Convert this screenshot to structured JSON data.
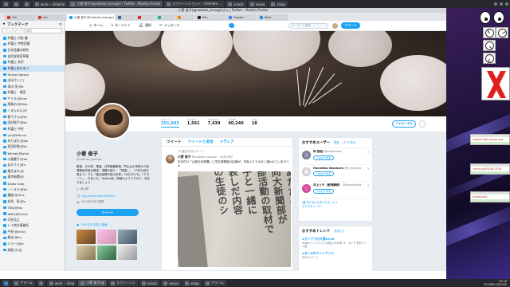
{
  "taskbar_top": {
    "tasks": [
      {
        "label": "",
        "active": false
      },
      {
        "label": "",
        "active": false
      },
      {
        "label": "",
        "active": false
      },
      {
        "label": "work -- Dolphin",
        "active": false
      },
      {
        "label": "小菅 俊子(@nobuko_kosuge) / Twitter - Mozilla Firefox",
        "active": true
      },
      {
        "label": "スクリーンショット - [homete ...",
        "active": false
      },
      {
        "label": "xclock",
        "active": false
      },
      {
        "label": "xeyes",
        "active": false
      },
      {
        "label": "xlogo",
        "active": false
      }
    ]
  },
  "browser": {
    "window_title": "小菅 俊子(@nobuko_kosuge)さん | Twitter - Mozilla Firefox",
    "tabs": [
      {
        "label": "Gm",
        "active": false
      },
      {
        "label": "Inb",
        "active": false
      },
      {
        "label": "小菅 俊子(@nobuko_kosuge)",
        "active": true
      },
      {
        "label": "",
        "active": false
      },
      {
        "label": "",
        "active": false
      },
      {
        "label": "",
        "active": false
      },
      {
        "label": "",
        "active": false
      },
      {
        "label": "Ello",
        "active": false
      },
      {
        "label": "Google",
        "active": false
      },
      {
        "label": "Mast",
        "active": false
      }
    ],
    "url": "https://twitter.com/nobuko_kosuge"
  },
  "sidebar": {
    "title": "ブックマーク",
    "search_placeholder": "ブックマークを検索",
    "items": [
      {
        "label": "弁護士 村松 謙",
        "selected": false
      },
      {
        "label": "弁護士 宇都宮健",
        "selected": false
      },
      {
        "label": "日本会議の研究",
        "selected": false
      },
      {
        "label": "自民党改憲草案",
        "selected": false
      },
      {
        "label": "弁護士 北村",
        "selected": false
      },
      {
        "label": "弁護士あかまつ",
        "selected": true
      },
      {
        "label": "Shoko Egawa(",
        "selected": false
      },
      {
        "label": "ばばけいこ(",
        "selected": false
      },
      {
        "label": "清水 潔(@k",
        "selected": false
      },
      {
        "label": "弁護士　堀田",
        "selected": false
      },
      {
        "label": "サイえ(@Fuw",
        "selected": false
      },
      {
        "label": "飛鳥の(@Hika",
        "selected": false
      },
      {
        "label": "くまんもん(@",
        "selected": false
      },
      {
        "label": "都下さん(@ta",
        "selected": false
      },
      {
        "label": "田村智子(@ta",
        "selected": false
      },
      {
        "label": "弁護士 中村",
        "selected": false
      },
      {
        "label": "y.b(@bfhuuz",
        "selected": false
      },
      {
        "label": "ゆとぽむ(@tol",
        "selected": false
      },
      {
        "label": "武田砂鉄(@ta",
        "selected": false
      },
      {
        "label": "Winkel(@wink",
        "selected": false
      },
      {
        "label": "小島慶子(@ke",
        "selected": false
      },
      {
        "label": "おのうえ(@n",
        "selected": false
      },
      {
        "label": "猫生まれ(@",
        "selected": false
      },
      {
        "label": "東京新聞(@",
        "selected": false
      },
      {
        "label": "Daiko Goto",
        "selected": false
      },
      {
        "label": "ノーステ(@ah",
        "selected": false
      },
      {
        "label": "蓮舫(@rens",
        "selected": false
      },
      {
        "label": "杉原　彰(@s",
        "selected": false
      },
      {
        "label": "TBS(@tbs",
        "selected": false
      },
      {
        "label": "SMU(@Schmi",
        "selected": false
      },
      {
        "label": "河合弘之",
        "selected": false
      },
      {
        "label": "レイ地方事務所",
        "selected": false
      },
      {
        "label": "今井(@shhcj",
        "selected": false
      },
      {
        "label": "勝ま(@ku",
        "selected": false
      },
      {
        "label": "ジョー(@ja",
        "selected": false
      },
      {
        "label": "高橋 大(@",
        "selected": false
      }
    ]
  },
  "twitter": {
    "nav": {
      "home": "ホーム",
      "moments": "モーメント",
      "notifications": "通知",
      "messages": "メッセージ"
    },
    "search_placeholder": "キーワード検索",
    "tweet_button": "ツイート",
    "stats": [
      {
        "label": "ツイート",
        "value": "151,563"
      },
      {
        "label": "フォロー",
        "value": "1,561"
      },
      {
        "label": "フォロワー",
        "value": "7,439"
      },
      {
        "label": "いいね",
        "value": "60,240"
      },
      {
        "label": "リスト",
        "value": "18"
      }
    ],
    "follow_button": "フォローする",
    "more_button": "⋮",
    "profile": {
      "name": "小菅 俊子",
      "handle": "@nobuko_kosuge",
      "bio": "尾道、江戸前、尾道。決学都都教育、門山は小学校から校理美術作陸大教室、書籍の使う、「物語」。「少年の目を見るフ」でも「東京経理の前の世界」「がだ子ども」「アロ一へ」、のあいだ。Twitter用。詳細のようですので、@ありましょう",
      "location": "東京都",
      "link": "log.jp/nobuko13064994",
      "joined": "2010年9月に登録",
      "tweet_button": "ツイート",
      "media_label": "793 件の写真と動画"
    },
    "timeline": {
      "tabs": [
        "ツイート",
        "ツイートと返信",
        "メディア"
      ],
      "pinned_label": "固定されたツイート",
      "tweet": {
        "name": "小菅 俊子",
        "handle": "@nobuko_kosuge",
        "date": "12月16日",
        "text": "本日付け「山梨日日新聞」に学生新聞部の記事が。写真入りで大きく扱われています!! #"
      },
      "newspaper_columns": [
        "あたためた",
        "同大新聞部が",
        "部活動の取材で",
        "子と一緒に",
        "表しだ内容",
        "の生徒のシ"
      ]
    },
    "who_to_follow": {
      "title": "おすすめユーザー",
      "update": "更新",
      "all": "すべて見る",
      "users": [
        {
          "name": "林 智裕",
          "handle": "@torakenrane",
          "button": "フォローする"
        },
        {
          "name": "Haruhiko Okumura",
          "handle": "@h_okumura",
          "button": "フォローする"
        },
        {
          "name": "井上リサ（紙飛機修）",
          "handle": "@inoueltsakee",
          "button": "フォローする"
        }
      ],
      "footer_1": "知り合いを見つけましょう",
      "footer_2": "おすすめユーザー"
    },
    "trends": {
      "title": "おすすめトレンド",
      "change": "変更する",
      "items": [
        {
          "name": "#ガイアプロ大賞2016",
          "desc": "Twitterアニメファンが選ぶ2016年 ザ・ガイア 新作アニメ選"
        },
        {
          "name": "#きく0のナイトアニメ",
          "desc": "Nikkei アニメ"
        }
      ]
    }
  },
  "desktop": {
    "xclock_windows": 3,
    "notes": [
      {
        "text": "tweeet-add-myxql-xyq"
      },
      {
        "text": "f.mmy-eg2016s-2016"
      },
      {
        "text": "screenshot"
      }
    ]
  },
  "taskbar_bottom": {
    "tasks": [
      {
        "label": "",
        "active": false
      },
      {
        "label": "アラーム",
        "active": false
      },
      {
        "label": "",
        "active": false
      },
      {
        "label": "work -- Dolp",
        "active": false
      },
      {
        "label": "小菅 俊子(@",
        "active": true
      },
      {
        "label": "スクリーンシ",
        "active": false
      },
      {
        "label": "xclock",
        "active": false
      },
      {
        "label": "xeyes",
        "active": false
      },
      {
        "label": "xlogo",
        "active": false
      },
      {
        "label": "アラーム",
        "active": false
      }
    ],
    "clock_time": "19:16",
    "clock_date": "2016年12月19日"
  },
  "colors": {
    "twitter_blue": "#1da1f2",
    "taskbar": "#26282d",
    "page_bg": "#e6ecf0"
  }
}
